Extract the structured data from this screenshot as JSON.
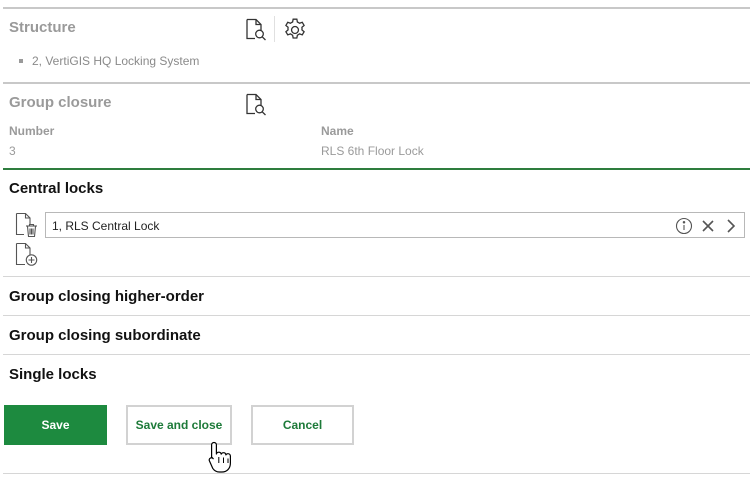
{
  "structure": {
    "title": "Structure",
    "items": [
      "2, VertiGIS HQ Locking System"
    ]
  },
  "group_closure": {
    "title": "Group closure",
    "number_label": "Number",
    "number_value": "3",
    "name_label": "Name",
    "name_value": "RLS 6th Floor Lock"
  },
  "central_locks": {
    "title": "Central locks",
    "items": [
      "1, RLS Central Lock"
    ]
  },
  "sections": {
    "higher_order": "Group closing higher-order",
    "subordinate": "Group closing subordinate",
    "single_locks": "Single locks"
  },
  "buttons": {
    "save": "Save",
    "save_and_close": "Save and close",
    "cancel": "Cancel"
  },
  "colors": {
    "accent_green": "#1d8a3f",
    "divider_green": "#2e7d3e",
    "muted_text": "#9a9a9a"
  }
}
